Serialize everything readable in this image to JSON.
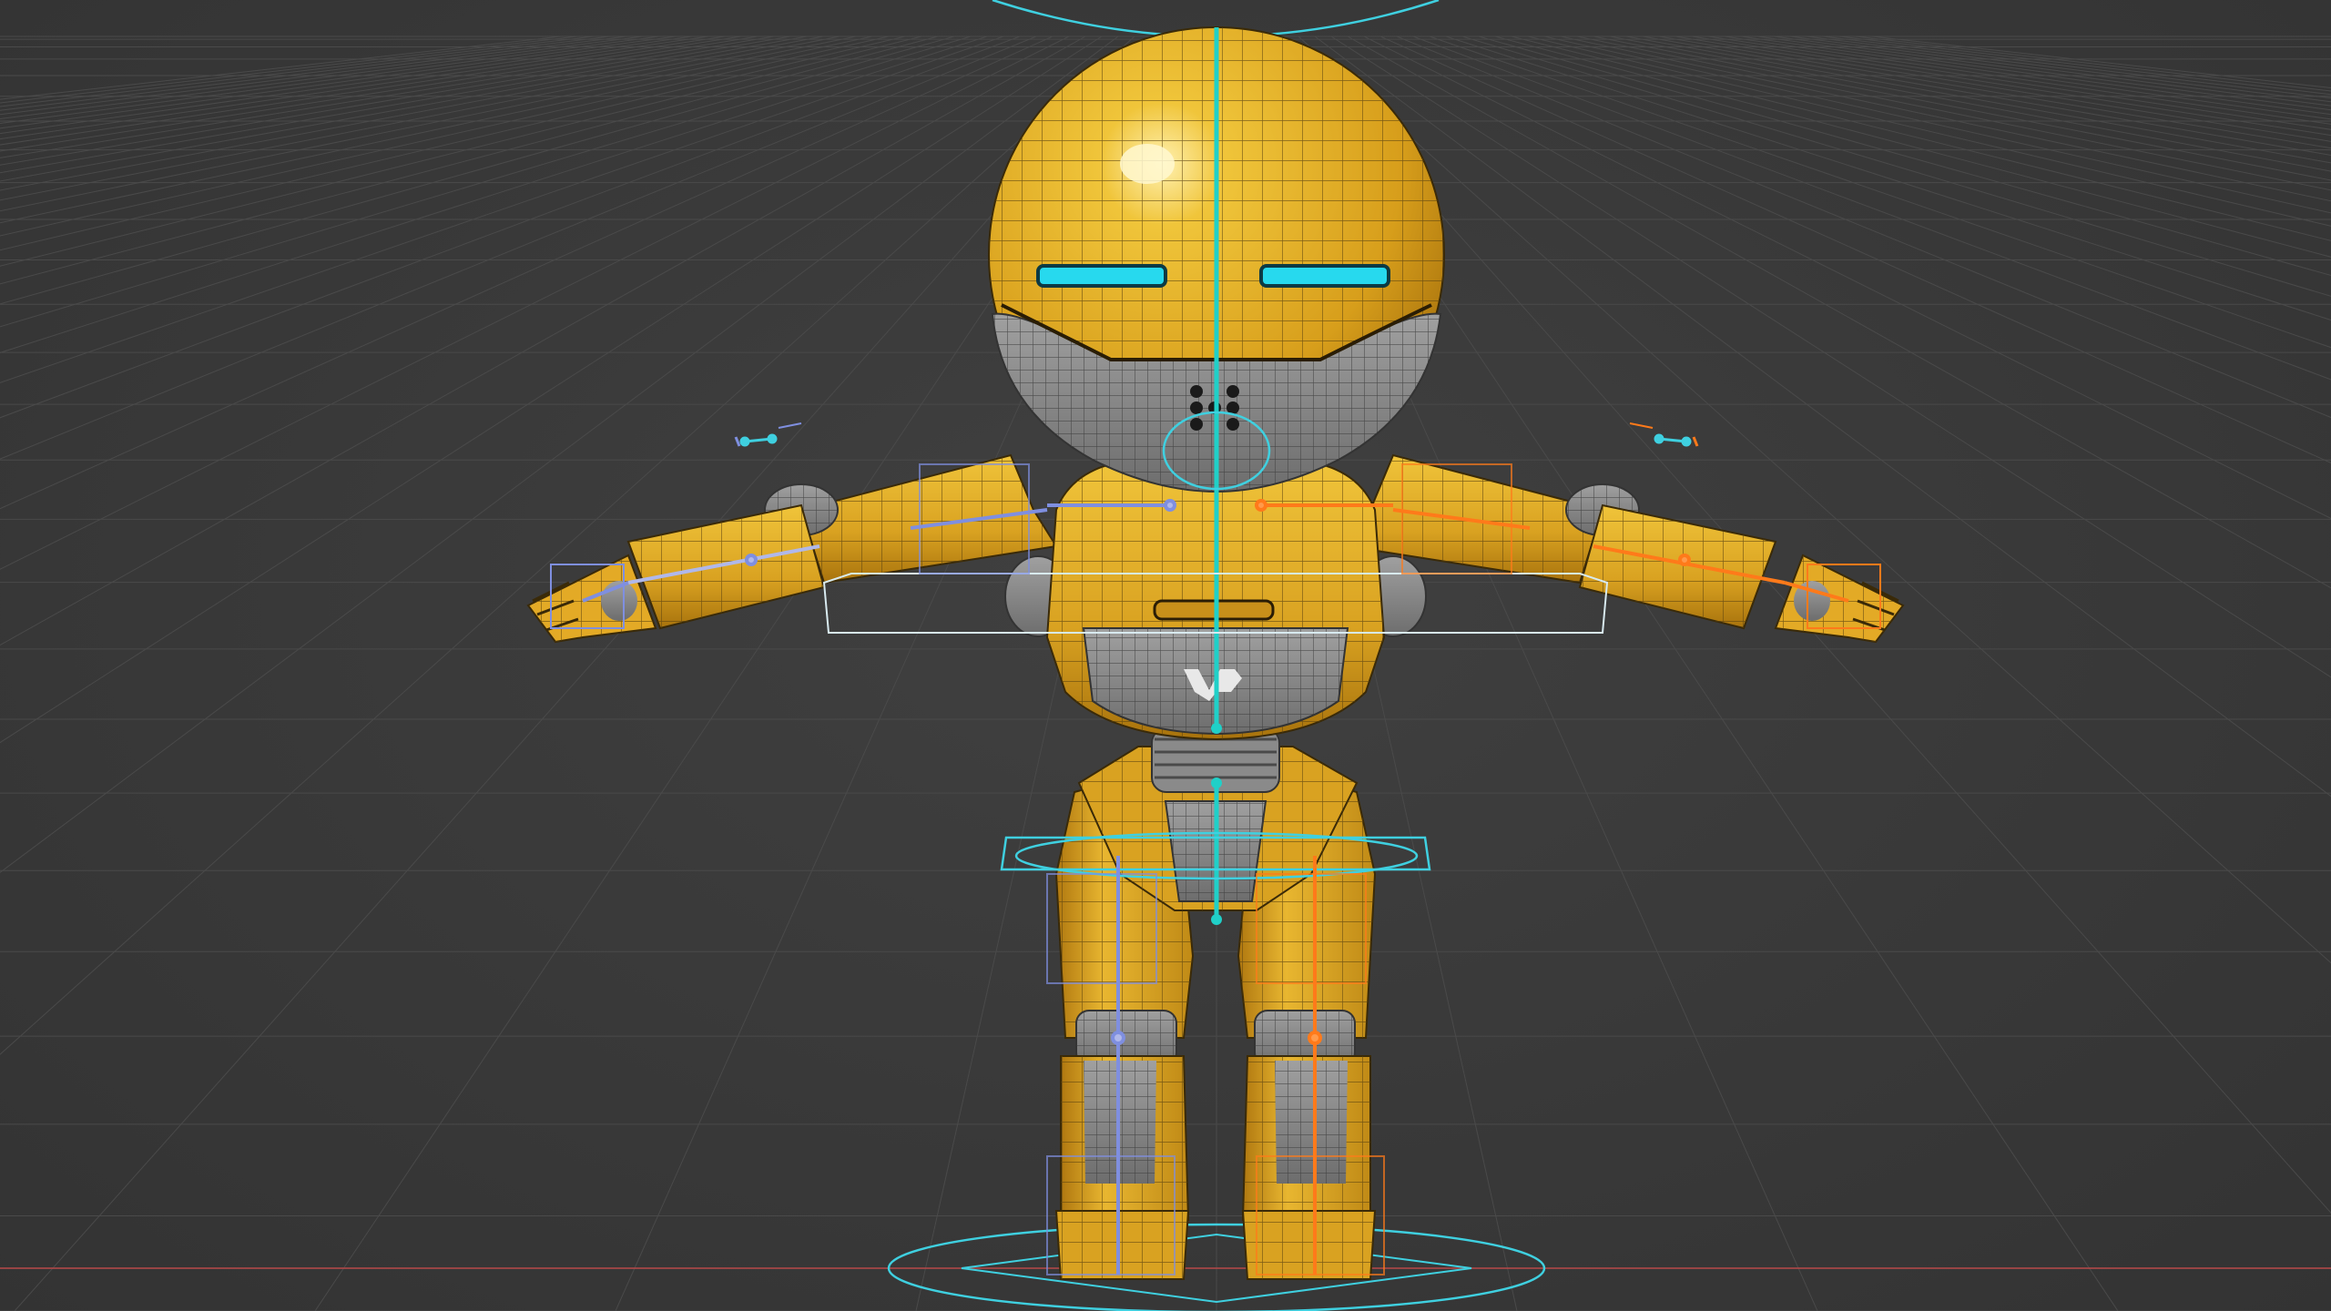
{
  "viewport": {
    "background": "#3a3a3a",
    "grid_color": "#4a4a4a",
    "x_axis_color": "#b04848"
  },
  "character": {
    "body_color": "#e0a823",
    "body_shade_color": "#b57f12",
    "joint_color": "#8c8c8c",
    "eye_color": "#27d9ee",
    "wire_color": "#2a2a2a"
  },
  "rig": {
    "center_bone_color": "#20d0c8",
    "left_bone_color": "#7f8fe0",
    "right_bone_color": "#ff7a1a",
    "control_color": "#3fd0e0",
    "pelvis_control_color": "#d8eaf0"
  },
  "icons": [
    "bone-icon"
  ]
}
